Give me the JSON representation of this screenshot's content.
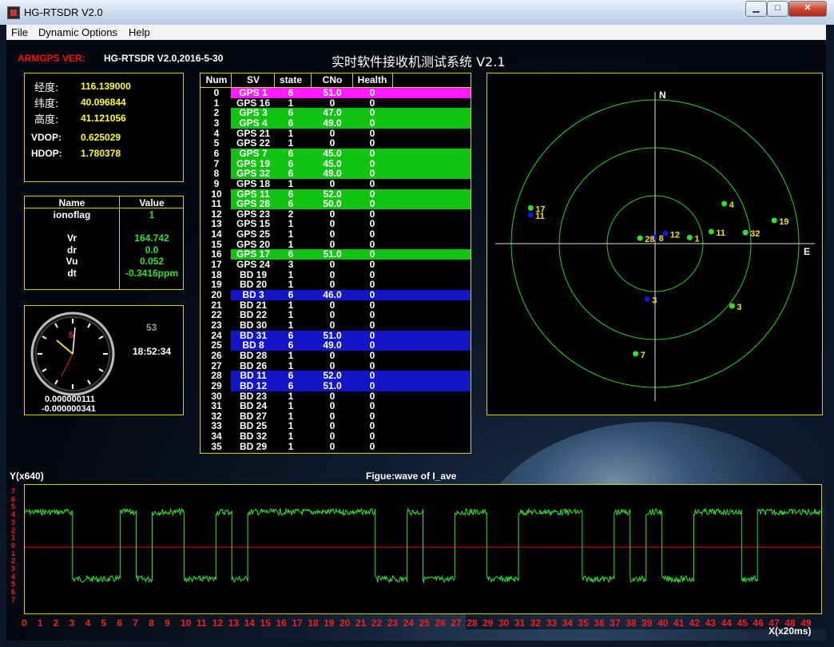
{
  "window": {
    "title": "HG-RTSDR V2.0",
    "min": "▁",
    "max": "□",
    "close": "✕"
  },
  "menu": [
    "File",
    "Dynamic Options",
    "Help"
  ],
  "header": {
    "version_label": "ARMGPS VER:",
    "version_value": "HG-RTSDR V2.0,2016-5-30",
    "system_title": "实时软件接收机测试系统 V2.1"
  },
  "position": {
    "lon_label": "经度:",
    "lon": "116.139000",
    "lat_label": "纬度:",
    "lat": "40.096844",
    "alt_label": "高度:",
    "alt": "41.121056",
    "vdop_label": "VDOP:",
    "vdop": "0.625029",
    "hdop_label": "HDOP:",
    "hdop": "1.780378"
  },
  "params": {
    "headers": [
      "Name",
      "Value"
    ],
    "rows": [
      {
        "name": "ionoflag",
        "value": "1"
      },
      {
        "name": "",
        "value": ""
      },
      {
        "name": "Vr",
        "value": "164.742"
      },
      {
        "name": "dr",
        "value": "0.0"
      },
      {
        "name": "Vu",
        "value": "0.052"
      },
      {
        "name": "dt",
        "value": "-0.3416ppm"
      }
    ]
  },
  "clock": {
    "seconds": "53",
    "time": "18:52:34",
    "hand_label": "5",
    "val1": "0.000000111",
    "val2": "-0.000000341"
  },
  "sat_table": {
    "headers": [
      "Num",
      "SV",
      "state",
      "CNo",
      "Health"
    ],
    "rows": [
      {
        "num": "0",
        "sv": "GPS 1",
        "state": "6",
        "cno": "51.0",
        "health": "0",
        "hl": "#ff1aff"
      },
      {
        "num": "1",
        "sv": "GPS 16",
        "state": "1",
        "cno": "0",
        "health": "0",
        "hl": ""
      },
      {
        "num": "2",
        "sv": "GPS 3",
        "state": "6",
        "cno": "47.0",
        "health": "0",
        "hl": "#12c412"
      },
      {
        "num": "3",
        "sv": "GPS 4",
        "state": "6",
        "cno": "49.0",
        "health": "0",
        "hl": "#12c412"
      },
      {
        "num": "4",
        "sv": "GPS 21",
        "state": "1",
        "cno": "0",
        "health": "0",
        "hl": ""
      },
      {
        "num": "5",
        "sv": "GPS 22",
        "state": "1",
        "cno": "0",
        "health": "0",
        "hl": ""
      },
      {
        "num": "6",
        "sv": "GPS 7",
        "state": "6",
        "cno": "45.0",
        "health": "0",
        "hl": "#12c412"
      },
      {
        "num": "7",
        "sv": "GPS 19",
        "state": "6",
        "cno": "45.0",
        "health": "0",
        "hl": "#12c412"
      },
      {
        "num": "8",
        "sv": "GPS 32",
        "state": "6",
        "cno": "49.0",
        "health": "0",
        "hl": "#12c412"
      },
      {
        "num": "9",
        "sv": "GPS 18",
        "state": "1",
        "cno": "0",
        "health": "0",
        "hl": ""
      },
      {
        "num": "10",
        "sv": "GPS 11",
        "state": "6",
        "cno": "52.0",
        "health": "0",
        "hl": "#12c412"
      },
      {
        "num": "11",
        "sv": "GPS 28",
        "state": "6",
        "cno": "50.0",
        "health": "0",
        "hl": "#12c412"
      },
      {
        "num": "12",
        "sv": "GPS 23",
        "state": "2",
        "cno": "0",
        "health": "0",
        "hl": ""
      },
      {
        "num": "13",
        "sv": "GPS 15",
        "state": "1",
        "cno": "0",
        "health": "0",
        "hl": ""
      },
      {
        "num": "14",
        "sv": "GPS 25",
        "state": "1",
        "cno": "0",
        "health": "0",
        "hl": ""
      },
      {
        "num": "15",
        "sv": "GPS 20",
        "state": "1",
        "cno": "0",
        "health": "0",
        "hl": ""
      },
      {
        "num": "16",
        "sv": "GPS 17",
        "state": "6",
        "cno": "51.0",
        "health": "0",
        "hl": "#12c412"
      },
      {
        "num": "17",
        "sv": "GPS 24",
        "state": "3",
        "cno": "0",
        "health": "0",
        "hl": ""
      },
      {
        "num": "18",
        "sv": "BD 19",
        "state": "1",
        "cno": "0",
        "health": "0",
        "hl": ""
      },
      {
        "num": "19",
        "sv": "BD 20",
        "state": "1",
        "cno": "0",
        "health": "0",
        "hl": ""
      },
      {
        "num": "20",
        "sv": "BD 3",
        "state": "6",
        "cno": "46.0",
        "health": "0",
        "hl": "#1414c8"
      },
      {
        "num": "21",
        "sv": "BD 21",
        "state": "1",
        "cno": "0",
        "health": "0",
        "hl": ""
      },
      {
        "num": "22",
        "sv": "BD 22",
        "state": "1",
        "cno": "0",
        "health": "0",
        "hl": ""
      },
      {
        "num": "23",
        "sv": "BD 30",
        "state": "1",
        "cno": "0",
        "health": "0",
        "hl": ""
      },
      {
        "num": "24",
        "sv": "BD 31",
        "state": "6",
        "cno": "51.0",
        "health": "0",
        "hl": "#1414c8"
      },
      {
        "num": "25",
        "sv": "BD 8",
        "state": "6",
        "cno": "49.0",
        "health": "0",
        "hl": "#1414c8"
      },
      {
        "num": "26",
        "sv": "BD 28",
        "state": "1",
        "cno": "0",
        "health": "0",
        "hl": ""
      },
      {
        "num": "27",
        "sv": "BD 26",
        "state": "1",
        "cno": "0",
        "health": "0",
        "hl": ""
      },
      {
        "num": "28",
        "sv": "BD 11",
        "state": "6",
        "cno": "52.0",
        "health": "0",
        "hl": "#1414c8"
      },
      {
        "num": "29",
        "sv": "BD 12",
        "state": "6",
        "cno": "51.0",
        "health": "0",
        "hl": "#1414c8"
      },
      {
        "num": "30",
        "sv": "BD 23",
        "state": "1",
        "cno": "0",
        "health": "0",
        "hl": ""
      },
      {
        "num": "31",
        "sv": "BD 24",
        "state": "1",
        "cno": "0",
        "health": "0",
        "hl": ""
      },
      {
        "num": "32",
        "sv": "BD 27",
        "state": "1",
        "cno": "0",
        "health": "0",
        "hl": ""
      },
      {
        "num": "33",
        "sv": "BD 25",
        "state": "1",
        "cno": "0",
        "health": "0",
        "hl": ""
      },
      {
        "num": "34",
        "sv": "BD 32",
        "state": "1",
        "cno": "0",
        "health": "0",
        "hl": ""
      },
      {
        "num": "35",
        "sv": "BD 29",
        "state": "1",
        "cno": "0",
        "health": "0",
        "hl": ""
      }
    ]
  },
  "skyplot": {
    "north": "N",
    "east": "E",
    "sats": [
      {
        "id": "4",
        "sys": "gps",
        "az": 60,
        "el": 40
      },
      {
        "id": "11",
        "sys": "gps",
        "az": 78,
        "el": 54
      },
      {
        "id": "19",
        "sys": "gps",
        "az": 79,
        "el": 14
      },
      {
        "id": "32",
        "sys": "gps",
        "az": 83,
        "el": 33
      },
      {
        "id": "1",
        "sys": "gps",
        "az": 80,
        "el": 68
      },
      {
        "id": "12",
        "sys": "bd",
        "az": 45,
        "el": 81
      },
      {
        "id": "8",
        "sys": "bd",
        "az": 350,
        "el": 86
      },
      {
        "id": "28",
        "sys": "gps",
        "az": 290,
        "el": 80
      },
      {
        "id": "17",
        "sys": "gps",
        "az": 286,
        "el": 9
      },
      {
        "id": "11",
        "sys": "bd",
        "az": 283,
        "el": 10
      },
      {
        "id": "3",
        "sys": "bd",
        "az": 188,
        "el": 55
      },
      {
        "id": "3",
        "sys": "gps",
        "az": 129,
        "el": 28
      },
      {
        "id": "7",
        "sys": "gps",
        "az": 190,
        "el": 20
      }
    ]
  },
  "wave": {
    "title": "Figue:wave of I_ave",
    "ylabel": "Y(x640)",
    "xlabel": "X(x20ms)",
    "yticks": [
      "7",
      "6",
      "5",
      "4",
      "3",
      "2",
      "1",
      "0",
      "1",
      "2",
      "3",
      "4",
      "5",
      "6",
      "7"
    ],
    "xticks": [
      "0",
      "1",
      "2",
      "3",
      "4",
      "5",
      "6",
      "7",
      "8",
      "9",
      "10",
      "11",
      "12",
      "13",
      "14",
      "15",
      "16",
      "17",
      "18",
      "19",
      "20",
      "21",
      "22",
      "23",
      "24",
      "25",
      "26",
      "27",
      "28",
      "29",
      "30",
      "31",
      "32",
      "33",
      "34",
      "35",
      "36",
      "37",
      "38",
      "39",
      "40",
      "41",
      "42",
      "43",
      "44",
      "45",
      "46",
      "47",
      "48",
      "49"
    ],
    "bits": [
      1,
      1,
      1,
      0,
      0,
      0,
      1,
      0,
      1,
      1,
      0,
      0,
      1,
      0,
      1,
      1,
      1,
      1,
      1,
      1,
      1,
      1,
      0,
      0,
      1,
      0,
      0,
      1,
      1,
      0,
      0,
      1,
      1,
      1,
      1,
      0,
      0,
      1,
      0,
      1,
      0,
      0,
      1,
      1,
      1,
      0,
      1,
      1,
      1,
      1
    ]
  },
  "colors": {
    "panel_border": "#d6d200",
    "gps": "#2fe02f",
    "bd": "#1414e0",
    "grid": "#2ad02a"
  }
}
